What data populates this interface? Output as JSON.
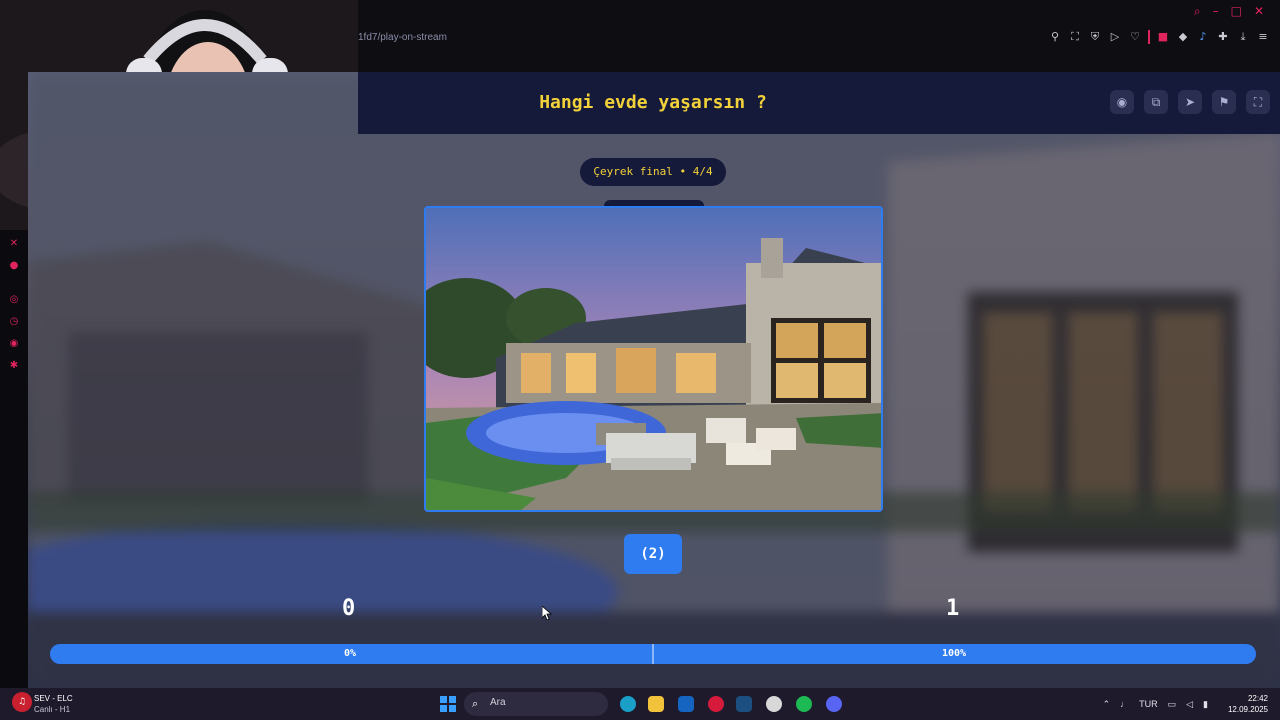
{
  "browser": {
    "url_fragment": "1fd7/play-on-stream"
  },
  "game": {
    "title": "Hangi evde yaşarsın ?",
    "round_badge": "Çeyrek final • 4/4",
    "choice_label": "(2)",
    "score_left": "0",
    "score_right": "1",
    "percent_left": "0%",
    "percent_right": "100%",
    "vote_share_left": 0,
    "vote_share_right": 1,
    "header_actions": [
      "eye-icon",
      "share-icon",
      "send-icon",
      "flag-icon",
      "fullscreen-icon"
    ]
  },
  "taskbar": {
    "now_playing_title": "SEV - ELC",
    "now_playing_subtitle": "Canlı - H1",
    "search_placeholder": "Ara",
    "language": "TUR",
    "time": "22:42",
    "date": "12.09.2025",
    "apps": [
      "edge",
      "file-explorer",
      "outlook",
      "opera",
      "steam",
      "github",
      "spotify",
      "discord"
    ]
  },
  "colors": {
    "accent": "#2f7bf0",
    "title": "#f2d23a",
    "header_bg": "#15193a",
    "brand_red": "#e0245e"
  }
}
